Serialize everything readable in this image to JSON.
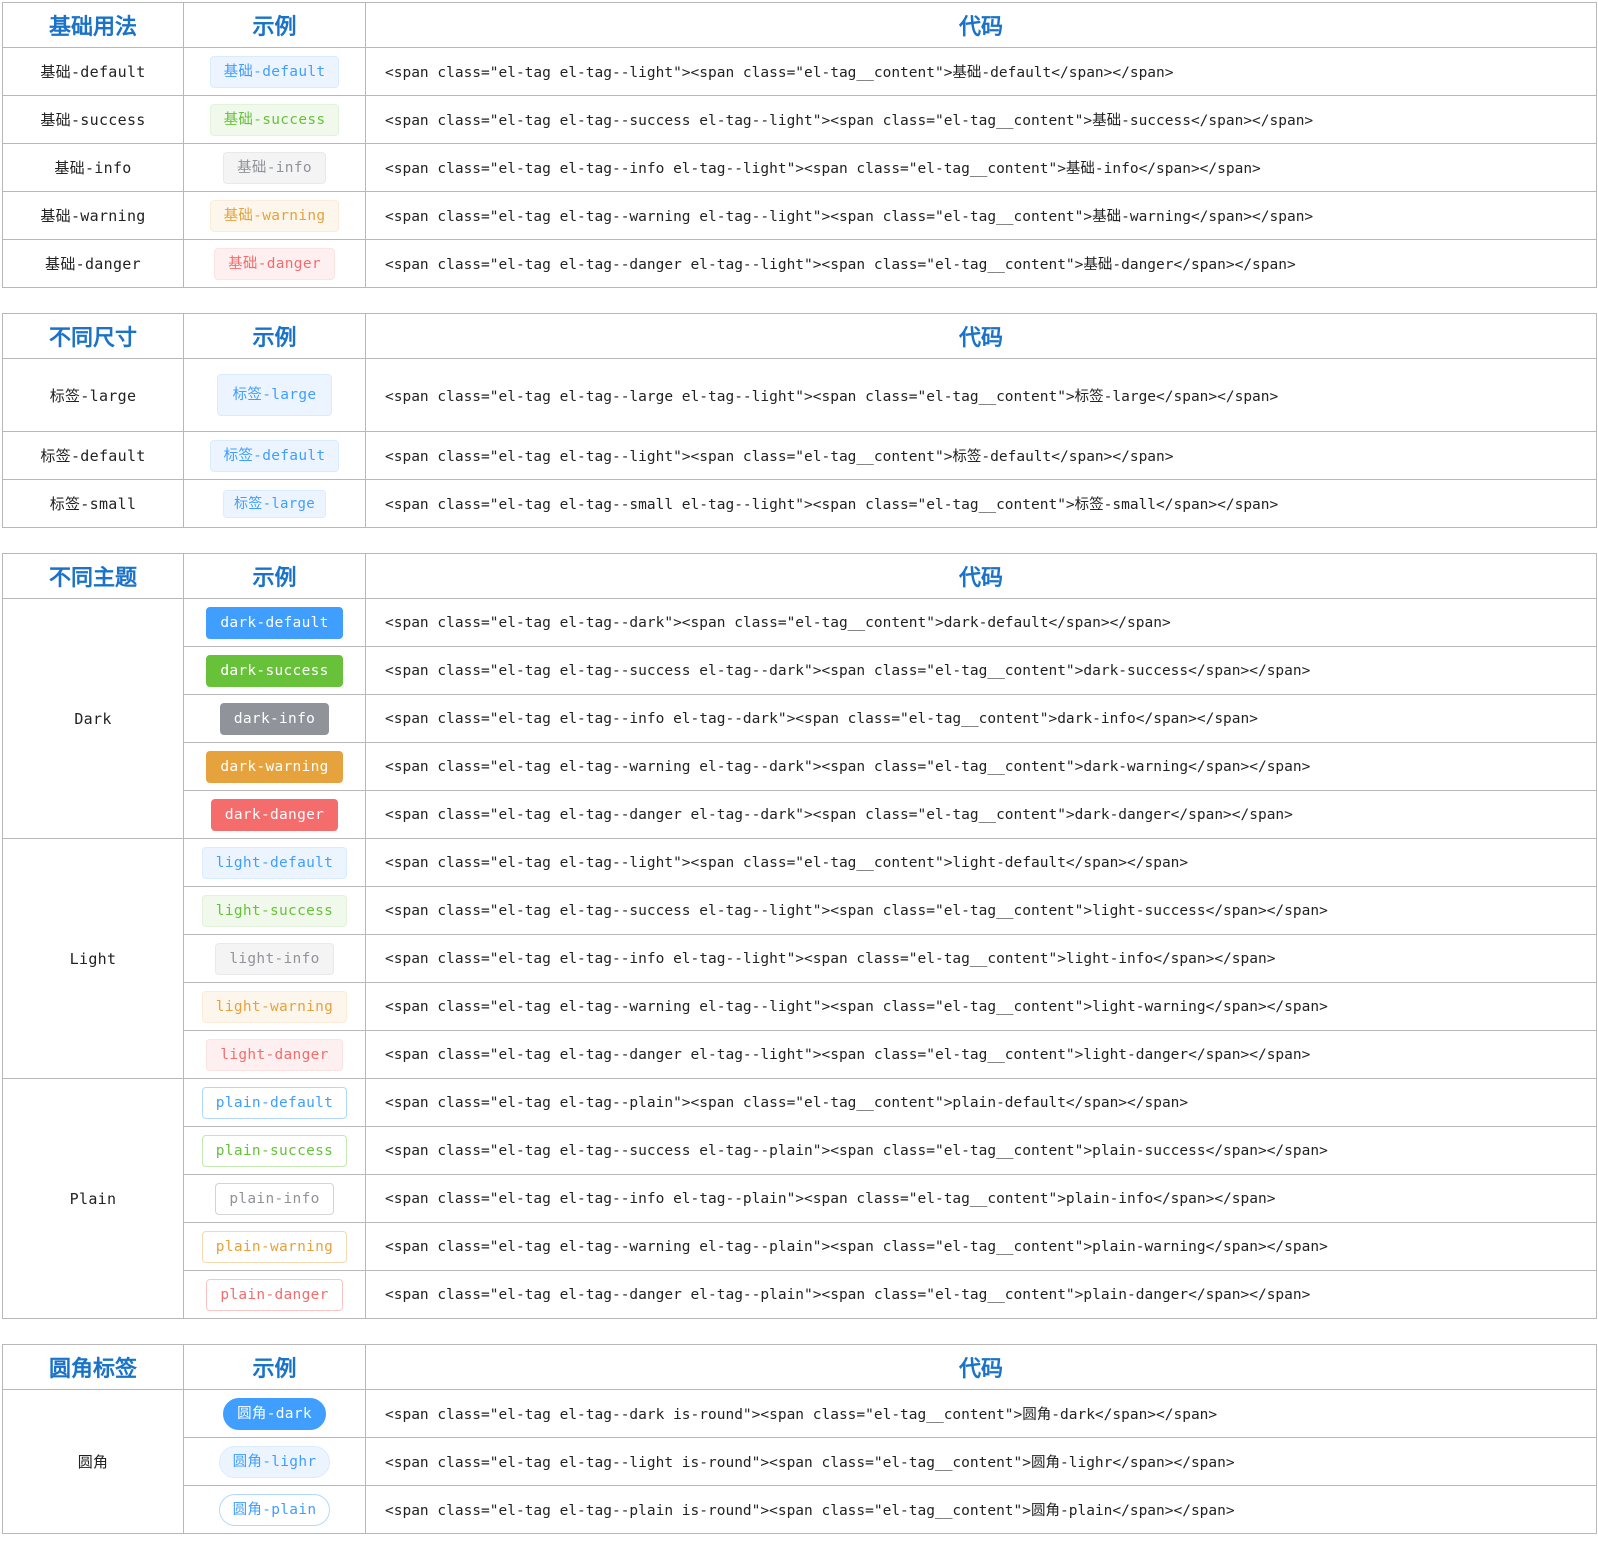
{
  "basic": {
    "headers": [
      "基础用法",
      "示例",
      "代码"
    ],
    "rows": [
      {
        "label": "基础-default",
        "tag": "基础-default",
        "code": "<span class=\"el-tag el-tag--light\"><span class=\"el-tag__content\">基础-default</span></span>"
      },
      {
        "label": "基础-success",
        "tag": "基础-success",
        "code": "<span class=\"el-tag el-tag--success el-tag--light\"><span class=\"el-tag__content\">基础-success</span></span>"
      },
      {
        "label": "基础-info",
        "tag": "基础-info",
        "code": "<span class=\"el-tag el-tag--info el-tag--light\"><span class=\"el-tag__content\">基础-info</span></span>"
      },
      {
        "label": "基础-warning",
        "tag": "基础-warning",
        "code": "<span class=\"el-tag el-tag--warning el-tag--light\"><span class=\"el-tag__content\">基础-warning</span></span>"
      },
      {
        "label": "基础-danger",
        "tag": "基础-danger",
        "code": "<span class=\"el-tag el-tag--danger el-tag--light\"><span class=\"el-tag__content\">基础-danger</span></span>"
      }
    ]
  },
  "sizes": {
    "headers": [
      "不同尺寸",
      "示例",
      "代码"
    ],
    "rows": [
      {
        "label": "标签-large",
        "tag": "标签-large",
        "code": "<span class=\"el-tag el-tag--large el-tag--light\"><span class=\"el-tag__content\">标签-large</span></span>"
      },
      {
        "label": "标签-default",
        "tag": "标签-default",
        "code": "<span class=\"el-tag el-tag--light\"><span class=\"el-tag__content\">标签-default</span></span>"
      },
      {
        "label": "标签-small",
        "tag": "标签-large",
        "code": "<span class=\"el-tag el-tag--small el-tag--light\"><span class=\"el-tag__content\">标签-small</span></span>"
      }
    ]
  },
  "themes": {
    "headers": [
      "不同主题",
      "示例",
      "代码"
    ],
    "groups": [
      {
        "label": "Dark",
        "rows": [
          {
            "tag": "dark-default",
            "code": "<span class=\"el-tag el-tag--dark\"><span class=\"el-tag__content\">dark-default</span></span>"
          },
          {
            "tag": "dark-success",
            "code": "<span class=\"el-tag el-tag--success el-tag--dark\"><span class=\"el-tag__content\">dark-success</span></span>"
          },
          {
            "tag": "dark-info",
            "code": "<span class=\"el-tag el-tag--info el-tag--dark\"><span class=\"el-tag__content\">dark-info</span></span>"
          },
          {
            "tag": "dark-warning",
            "code": "<span class=\"el-tag el-tag--warning el-tag--dark\"><span class=\"el-tag__content\">dark-warning</span></span>"
          },
          {
            "tag": "dark-danger",
            "code": "<span class=\"el-tag el-tag--danger el-tag--dark\"><span class=\"el-tag__content\">dark-danger</span></span>"
          }
        ]
      },
      {
        "label": "Light",
        "rows": [
          {
            "tag": "light-default",
            "code": "<span class=\"el-tag el-tag--light\"><span class=\"el-tag__content\">light-default</span></span>"
          },
          {
            "tag": "light-success",
            "code": "<span class=\"el-tag el-tag--success el-tag--light\"><span class=\"el-tag__content\">light-success</span></span>"
          },
          {
            "tag": "light-info",
            "code": "<span class=\"el-tag el-tag--info el-tag--light\"><span class=\"el-tag__content\">light-info</span></span>"
          },
          {
            "tag": "light-warning",
            "code": "<span class=\"el-tag el-tag--warning el-tag--light\"><span class=\"el-tag__content\">light-warning</span></span>"
          },
          {
            "tag": "light-danger",
            "code": "<span class=\"el-tag el-tag--danger el-tag--light\"><span class=\"el-tag__content\">light-danger</span></span>"
          }
        ]
      },
      {
        "label": "Plain",
        "rows": [
          {
            "tag": "plain-default",
            "code": "<span class=\"el-tag el-tag--plain\"><span class=\"el-tag__content\">plain-default</span></span>"
          },
          {
            "tag": "plain-success",
            "code": "<span class=\"el-tag el-tag--success el-tag--plain\"><span class=\"el-tag__content\">plain-success</span></span>"
          },
          {
            "tag": "plain-info",
            "code": "<span class=\"el-tag el-tag--info el-tag--plain\"><span class=\"el-tag__content\">plain-info</span></span>"
          },
          {
            "tag": "plain-warning",
            "code": "<span class=\"el-tag el-tag--warning el-tag--plain\"><span class=\"el-tag__content\">plain-warning</span></span>"
          },
          {
            "tag": "plain-danger",
            "code": "<span class=\"el-tag el-tag--danger el-tag--plain\"><span class=\"el-tag__content\">plain-danger</span></span>"
          }
        ]
      }
    ]
  },
  "round": {
    "headers": [
      "圆角标签",
      "示例",
      "代码"
    ],
    "label": "圆角",
    "rows": [
      {
        "tag": "圆角-dark",
        "code": "<span class=\"el-tag el-tag--dark is-round\"><span class=\"el-tag__content\">圆角-dark</span></span>"
      },
      {
        "tag": "圆角-lighr",
        "code": "<span class=\"el-tag el-tag--light is-round\"><span class=\"el-tag__content\">圆角-lighr</span></span>"
      },
      {
        "tag": "圆角-plain",
        "code": "<span class=\"el-tag el-tag--plain is-round\"><span class=\"el-tag__content\">圆角-plain</span></span>"
      }
    ]
  },
  "colors": {
    "header_text": "#1a73c8",
    "primary": "#409eff",
    "success": "#67c23a",
    "info": "#909399",
    "warning": "#e6a23c",
    "danger": "#f56c6c"
  }
}
